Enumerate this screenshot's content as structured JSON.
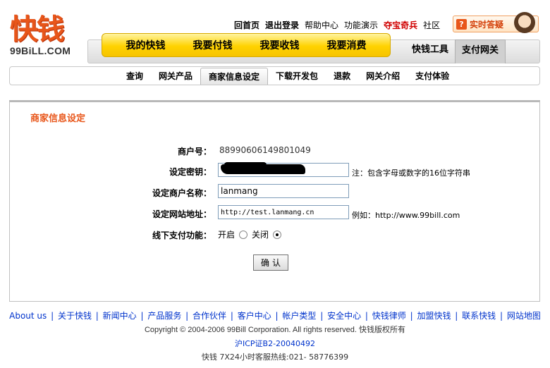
{
  "logo": {
    "cn": "快钱",
    "en": "99BiLL.COM"
  },
  "toplinks": [
    {
      "label": "回首页",
      "style": "b"
    },
    {
      "label": "退出登录",
      "style": "b"
    },
    {
      "label": "帮助中心",
      "style": ""
    },
    {
      "label": "功能演示",
      "style": ""
    },
    {
      "label": "夺宝奇兵",
      "style": "red"
    },
    {
      "label": "社区",
      "style": ""
    }
  ],
  "livehelp": {
    "label": "实时答疑",
    "icon": "question-icon"
  },
  "main_tabs": [
    "我的快钱",
    "我要付钱",
    "我要收钱",
    "我要消费"
  ],
  "right_tabs": [
    {
      "label": "快钱工具",
      "active": false
    },
    {
      "label": "支付网关",
      "active": true
    }
  ],
  "subnav": [
    {
      "label": "查询",
      "active": false
    },
    {
      "label": "网关产品",
      "active": false
    },
    {
      "label": "商家信息设定",
      "active": true
    },
    {
      "label": "下载开发包",
      "active": false
    },
    {
      "label": "退款",
      "active": false
    },
    {
      "label": "网关介绍",
      "active": false
    },
    {
      "label": "支付体验",
      "active": false
    }
  ],
  "panel": {
    "title": "商家信息设定",
    "merchant_id_label": "商户号：",
    "merchant_id_value": "88990606149801049",
    "key_label": "设定密钥：",
    "key_note": "注：包含字母或数字的16位字符串",
    "name_label": "设定商户名称：",
    "name_value": "lanmang",
    "site_label": "设定网站地址：",
    "site_value": "http://test.lanmang.cn",
    "site_note": "例如：http://www.99bill.com",
    "offline_label": "线下支付功能：",
    "offline_on": "开启",
    "offline_off": "关闭",
    "offline_selected": "关闭",
    "confirm": "确认"
  },
  "footer": {
    "links": [
      "About us",
      "关于快钱",
      "新闻中心",
      "产品服务",
      "合作伙伴",
      "客户中心",
      "帐户类型",
      "安全中心",
      "快钱律师",
      "加盟快钱",
      "联系快钱",
      "网站地图"
    ],
    "copyright": "Copyright © 2004-2006 99Bill Corporation. All rights reserved. 快钱版权所有",
    "icp": "沪ICP证B2-20040492",
    "hotline": "快钱  7X24小时客服热线:021- 58776399"
  },
  "colors": {
    "brand_orange": "#e8561a",
    "tab_yellow": "#ffd200",
    "link_blue": "#0033cc"
  }
}
